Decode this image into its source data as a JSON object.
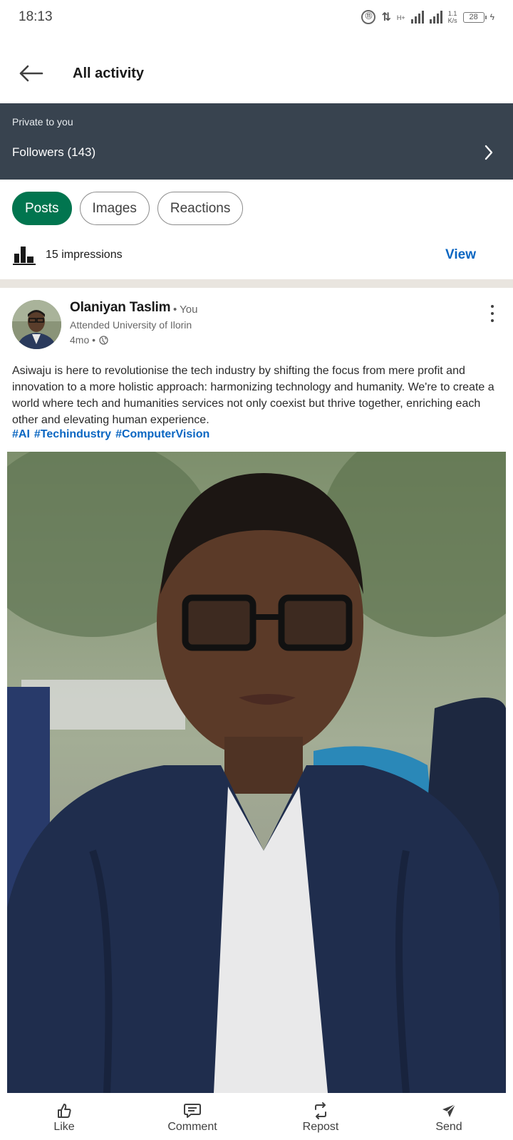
{
  "status_bar": {
    "time": "18:13",
    "network_type": "H+",
    "speed_value": "1.1",
    "speed_unit": "K/s",
    "battery": "28"
  },
  "header": {
    "title": "All activity",
    "back_icon": "arrow-left-icon"
  },
  "private_banner": {
    "label": "Private to you",
    "followers": "Followers (143)"
  },
  "tabs": [
    {
      "label": "Posts",
      "active": true
    },
    {
      "label": "Images",
      "active": false
    },
    {
      "label": "Reactions",
      "active": false
    }
  ],
  "impressions": {
    "text": "15 impressions",
    "view_label": "View"
  },
  "post": {
    "author": "Olaniyan Taslim",
    "you_label": "• You",
    "subtitle": "Attended University of Ilorin",
    "time": "4mo •",
    "body": "Asiwaju is here to revolutionise the tech industry by shifting the focus from mere profit and innovation to a more holistic approach: harmonizing technology and humanity. We're to create a world where tech and humanities services not only coexist but thrive together, enriching each other and elevating human experience.",
    "hashtags": [
      "#AI",
      "#Techindustry",
      "#ComputerVision"
    ]
  },
  "actions": [
    {
      "label": "Like",
      "icon": "thumbs-up-icon"
    },
    {
      "label": "Comment",
      "icon": "comment-icon"
    },
    {
      "label": "Repost",
      "icon": "repost-icon"
    },
    {
      "label": "Send",
      "icon": "send-icon"
    }
  ],
  "colors": {
    "accent_green": "#01754f",
    "link_blue": "#0a66c2",
    "banner_bg": "#38434f"
  }
}
